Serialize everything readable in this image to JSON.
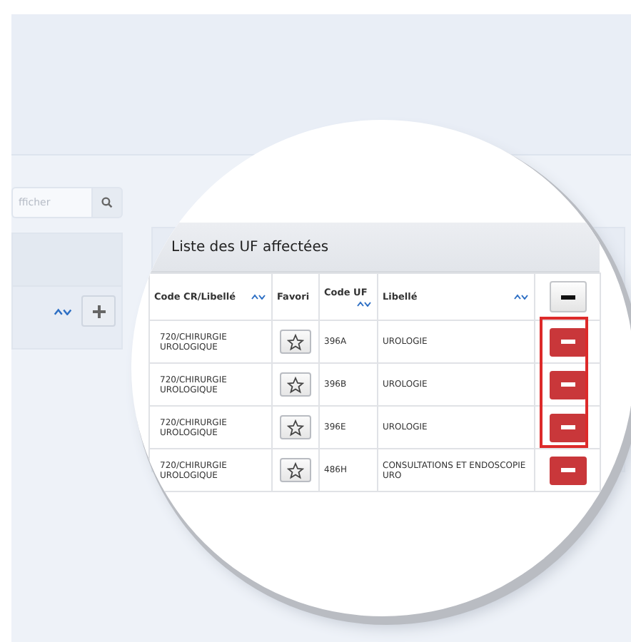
{
  "search": {
    "placeholder": "fficher"
  },
  "assigned_units": {
    "title": "Liste des UF affectées",
    "columns": [
      {
        "label": "Code CR/Libellé",
        "sortable": true
      },
      {
        "label": "Favori",
        "sortable": false
      },
      {
        "label": "Code UF",
        "sortable": true
      },
      {
        "label": "Libellé",
        "sortable": true
      }
    ],
    "rows": [
      {
        "code_cr": "720/CHIRURGIE UROLOGIQUE",
        "favorite": false,
        "code_uf": "396A",
        "libelle": "UROLOGIE",
        "highlighted": true
      },
      {
        "code_cr": "720/CHIRURGIE UROLOGIQUE",
        "favorite": false,
        "code_uf": "396B",
        "libelle": "UROLOGIE",
        "highlighted": true
      },
      {
        "code_cr": "720/CHIRURGIE UROLOGIQUE",
        "favorite": false,
        "code_uf": "396E",
        "libelle": "UROLOGIE",
        "highlighted": true
      },
      {
        "code_cr": "720/CHIRURGIE UROLOGIQUE",
        "favorite": false,
        "code_uf": "486H",
        "libelle": "CONSULTATIONS ET ENDOSCOPIE URO",
        "highlighted": false
      }
    ]
  }
}
